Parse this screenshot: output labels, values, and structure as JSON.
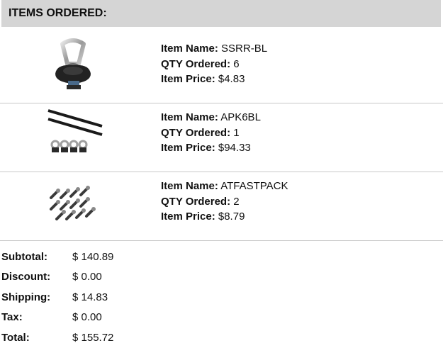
{
  "header": {
    "title": "ITEMS ORDERED:"
  },
  "labels": {
    "item_name": "Item Name:",
    "qty": "QTY Ordered:",
    "price": "Item Price:"
  },
  "items": [
    {
      "name": "SSRR-BL",
      "qty": "6",
      "price": "$4.83",
      "image_icon": "ring-anchor-icon"
    },
    {
      "name": "APK6BL",
      "qty": "1",
      "price": "$94.33",
      "image_icon": "track-kit-icon"
    },
    {
      "name": "ATFASTPACK",
      "qty": "2",
      "price": "$8.79",
      "image_icon": "bolt-pack-icon"
    }
  ],
  "totals": [
    {
      "label": "Subtotal:",
      "value": "$ 140.89"
    },
    {
      "label": "Discount:",
      "value": "$ 0.00"
    },
    {
      "label": "Shipping:",
      "value": "$ 14.83"
    },
    {
      "label": "Tax:",
      "value": "$ 0.00"
    },
    {
      "label": "Total:",
      "value": "$ 155.72"
    }
  ],
  "colors": {
    "header_bg": "#d5d5d5",
    "divider": "#c8c8c8"
  }
}
